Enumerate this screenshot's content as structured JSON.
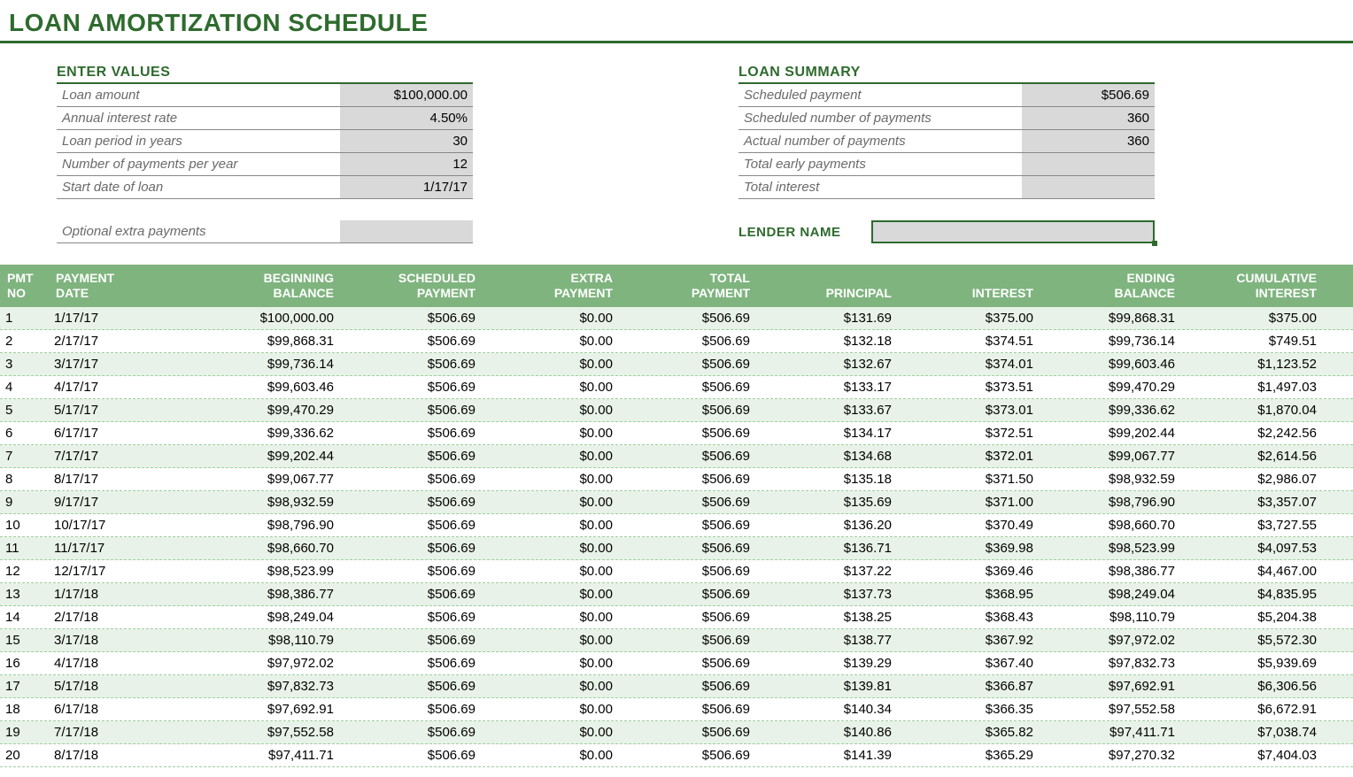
{
  "title": "LOAN AMORTIZATION SCHEDULE",
  "enter_values": {
    "heading": "ENTER VALUES",
    "rows": {
      "loan_amount": {
        "label": "Loan amount",
        "value": "$100,000.00"
      },
      "annual_rate": {
        "label": "Annual interest rate",
        "value": "4.50%"
      },
      "loan_years": {
        "label": "Loan period in years",
        "value": "30"
      },
      "payments_per_year": {
        "label": "Number of payments per year",
        "value": "12"
      },
      "start_date": {
        "label": "Start date of loan",
        "value": "1/17/17"
      },
      "optional_extra": {
        "label": "Optional extra payments",
        "value": ""
      }
    }
  },
  "loan_summary": {
    "heading": "LOAN SUMMARY",
    "rows": {
      "scheduled_payment": {
        "label": "Scheduled payment",
        "value": "$506.69"
      },
      "scheduled_num": {
        "label": "Scheduled number of payments",
        "value": "360"
      },
      "actual_num": {
        "label": "Actual number of payments",
        "value": "360"
      },
      "total_early": {
        "label": "Total early payments",
        "value": ""
      },
      "total_interest": {
        "label": "Total interest",
        "value": ""
      }
    },
    "lender_label": "LENDER NAME",
    "lender_value": ""
  },
  "schedule": {
    "headers": {
      "c0a": "PMT",
      "c0b": "NO",
      "c1a": "PAYMENT",
      "c1b": "DATE",
      "c2a": "BEGINNING",
      "c2b": "BALANCE",
      "c3a": "SCHEDULED",
      "c3b": "PAYMENT",
      "c4a": "EXTRA",
      "c4b": "PAYMENT",
      "c5a": "TOTAL",
      "c5b": "PAYMENT",
      "c6": "PRINCIPAL",
      "c7": "INTEREST",
      "c8a": "ENDING",
      "c8b": "BALANCE",
      "c9a": "CUMULATIVE",
      "c9b": "INTEREST"
    },
    "rows": [
      {
        "no": "1",
        "date": "1/17/17",
        "beg": "$100,000.00",
        "sch": "$506.69",
        "ext": "$0.00",
        "tot": "$506.69",
        "prin": "$131.69",
        "intr": "$375.00",
        "end": "$99,868.31",
        "cum": "$375.00"
      },
      {
        "no": "2",
        "date": "2/17/17",
        "beg": "$99,868.31",
        "sch": "$506.69",
        "ext": "$0.00",
        "tot": "$506.69",
        "prin": "$132.18",
        "intr": "$374.51",
        "end": "$99,736.14",
        "cum": "$749.51"
      },
      {
        "no": "3",
        "date": "3/17/17",
        "beg": "$99,736.14",
        "sch": "$506.69",
        "ext": "$0.00",
        "tot": "$506.69",
        "prin": "$132.67",
        "intr": "$374.01",
        "end": "$99,603.46",
        "cum": "$1,123.52"
      },
      {
        "no": "4",
        "date": "4/17/17",
        "beg": "$99,603.46",
        "sch": "$506.69",
        "ext": "$0.00",
        "tot": "$506.69",
        "prin": "$133.17",
        "intr": "$373.51",
        "end": "$99,470.29",
        "cum": "$1,497.03"
      },
      {
        "no": "5",
        "date": "5/17/17",
        "beg": "$99,470.29",
        "sch": "$506.69",
        "ext": "$0.00",
        "tot": "$506.69",
        "prin": "$133.67",
        "intr": "$373.01",
        "end": "$99,336.62",
        "cum": "$1,870.04"
      },
      {
        "no": "6",
        "date": "6/17/17",
        "beg": "$99,336.62",
        "sch": "$506.69",
        "ext": "$0.00",
        "tot": "$506.69",
        "prin": "$134.17",
        "intr": "$372.51",
        "end": "$99,202.44",
        "cum": "$2,242.56"
      },
      {
        "no": "7",
        "date": "7/17/17",
        "beg": "$99,202.44",
        "sch": "$506.69",
        "ext": "$0.00",
        "tot": "$506.69",
        "prin": "$134.68",
        "intr": "$372.01",
        "end": "$99,067.77",
        "cum": "$2,614.56"
      },
      {
        "no": "8",
        "date": "8/17/17",
        "beg": "$99,067.77",
        "sch": "$506.69",
        "ext": "$0.00",
        "tot": "$506.69",
        "prin": "$135.18",
        "intr": "$371.50",
        "end": "$98,932.59",
        "cum": "$2,986.07"
      },
      {
        "no": "9",
        "date": "9/17/17",
        "beg": "$98,932.59",
        "sch": "$506.69",
        "ext": "$0.00",
        "tot": "$506.69",
        "prin": "$135.69",
        "intr": "$371.00",
        "end": "$98,796.90",
        "cum": "$3,357.07"
      },
      {
        "no": "10",
        "date": "10/17/17",
        "beg": "$98,796.90",
        "sch": "$506.69",
        "ext": "$0.00",
        "tot": "$506.69",
        "prin": "$136.20",
        "intr": "$370.49",
        "end": "$98,660.70",
        "cum": "$3,727.55"
      },
      {
        "no": "11",
        "date": "11/17/17",
        "beg": "$98,660.70",
        "sch": "$506.69",
        "ext": "$0.00",
        "tot": "$506.69",
        "prin": "$136.71",
        "intr": "$369.98",
        "end": "$98,523.99",
        "cum": "$4,097.53"
      },
      {
        "no": "12",
        "date": "12/17/17",
        "beg": "$98,523.99",
        "sch": "$506.69",
        "ext": "$0.00",
        "tot": "$506.69",
        "prin": "$137.22",
        "intr": "$369.46",
        "end": "$98,386.77",
        "cum": "$4,467.00"
      },
      {
        "no": "13",
        "date": "1/17/18",
        "beg": "$98,386.77",
        "sch": "$506.69",
        "ext": "$0.00",
        "tot": "$506.69",
        "prin": "$137.73",
        "intr": "$368.95",
        "end": "$98,249.04",
        "cum": "$4,835.95"
      },
      {
        "no": "14",
        "date": "2/17/18",
        "beg": "$98,249.04",
        "sch": "$506.69",
        "ext": "$0.00",
        "tot": "$506.69",
        "prin": "$138.25",
        "intr": "$368.43",
        "end": "$98,110.79",
        "cum": "$5,204.38"
      },
      {
        "no": "15",
        "date": "3/17/18",
        "beg": "$98,110.79",
        "sch": "$506.69",
        "ext": "$0.00",
        "tot": "$506.69",
        "prin": "$138.77",
        "intr": "$367.92",
        "end": "$97,972.02",
        "cum": "$5,572.30"
      },
      {
        "no": "16",
        "date": "4/17/18",
        "beg": "$97,972.02",
        "sch": "$506.69",
        "ext": "$0.00",
        "tot": "$506.69",
        "prin": "$139.29",
        "intr": "$367.40",
        "end": "$97,832.73",
        "cum": "$5,939.69"
      },
      {
        "no": "17",
        "date": "5/17/18",
        "beg": "$97,832.73",
        "sch": "$506.69",
        "ext": "$0.00",
        "tot": "$506.69",
        "prin": "$139.81",
        "intr": "$366.87",
        "end": "$97,692.91",
        "cum": "$6,306.56"
      },
      {
        "no": "18",
        "date": "6/17/18",
        "beg": "$97,692.91",
        "sch": "$506.69",
        "ext": "$0.00",
        "tot": "$506.69",
        "prin": "$140.34",
        "intr": "$366.35",
        "end": "$97,552.58",
        "cum": "$6,672.91"
      },
      {
        "no": "19",
        "date": "7/17/18",
        "beg": "$97,552.58",
        "sch": "$506.69",
        "ext": "$0.00",
        "tot": "$506.69",
        "prin": "$140.86",
        "intr": "$365.82",
        "end": "$97,411.71",
        "cum": "$7,038.74"
      },
      {
        "no": "20",
        "date": "8/17/18",
        "beg": "$97,411.71",
        "sch": "$506.69",
        "ext": "$0.00",
        "tot": "$506.69",
        "prin": "$141.39",
        "intr": "$365.29",
        "end": "$97,270.32",
        "cum": "$7,404.03"
      }
    ]
  },
  "chart_data": {
    "type": "table",
    "title": "Loan Amortization Schedule",
    "columns": [
      "PMT NO",
      "PAYMENT DATE",
      "BEGINNING BALANCE",
      "SCHEDULED PAYMENT",
      "EXTRA PAYMENT",
      "TOTAL PAYMENT",
      "PRINCIPAL",
      "INTEREST",
      "ENDING BALANCE",
      "CUMULATIVE INTEREST"
    ],
    "rows": [
      [
        1,
        "1/17/17",
        100000.0,
        506.69,
        0.0,
        506.69,
        131.69,
        375.0,
        99868.31,
        375.0
      ],
      [
        2,
        "2/17/17",
        99868.31,
        506.69,
        0.0,
        506.69,
        132.18,
        374.51,
        99736.14,
        749.51
      ],
      [
        3,
        "3/17/17",
        99736.14,
        506.69,
        0.0,
        506.69,
        132.67,
        374.01,
        99603.46,
        1123.52
      ],
      [
        4,
        "4/17/17",
        99603.46,
        506.69,
        0.0,
        506.69,
        133.17,
        373.51,
        99470.29,
        1497.03
      ],
      [
        5,
        "5/17/17",
        99470.29,
        506.69,
        0.0,
        506.69,
        133.67,
        373.01,
        99336.62,
        1870.04
      ],
      [
        6,
        "6/17/17",
        99336.62,
        506.69,
        0.0,
        506.69,
        134.17,
        372.51,
        99202.44,
        2242.56
      ],
      [
        7,
        "7/17/17",
        99202.44,
        506.69,
        0.0,
        506.69,
        134.68,
        372.01,
        99067.77,
        2614.56
      ],
      [
        8,
        "8/17/17",
        99067.77,
        506.69,
        0.0,
        506.69,
        135.18,
        371.5,
        98932.59,
        2986.07
      ],
      [
        9,
        "9/17/17",
        98932.59,
        506.69,
        0.0,
        506.69,
        135.69,
        371.0,
        98796.9,
        3357.07
      ],
      [
        10,
        "10/17/17",
        98796.9,
        506.69,
        0.0,
        506.69,
        136.2,
        370.49,
        98660.7,
        3727.55
      ],
      [
        11,
        "11/17/17",
        98660.7,
        506.69,
        0.0,
        506.69,
        136.71,
        369.98,
        98523.99,
        4097.53
      ],
      [
        12,
        "12/17/17",
        98523.99,
        506.69,
        0.0,
        506.69,
        137.22,
        369.46,
        98386.77,
        4467.0
      ],
      [
        13,
        "1/17/18",
        98386.77,
        506.69,
        0.0,
        506.69,
        137.73,
        368.95,
        98249.04,
        4835.95
      ],
      [
        14,
        "2/17/18",
        98249.04,
        506.69,
        0.0,
        506.69,
        138.25,
        368.43,
        98110.79,
        5204.38
      ],
      [
        15,
        "3/17/18",
        98110.79,
        506.69,
        0.0,
        506.69,
        138.77,
        367.92,
        97972.02,
        5572.3
      ],
      [
        16,
        "4/17/18",
        97972.02,
        506.69,
        0.0,
        506.69,
        139.29,
        367.4,
        97832.73,
        5939.69
      ],
      [
        17,
        "5/17/18",
        97832.73,
        506.69,
        0.0,
        506.69,
        139.81,
        366.87,
        97692.91,
        6306.56
      ],
      [
        18,
        "6/17/18",
        97692.91,
        506.69,
        0.0,
        506.69,
        140.34,
        366.35,
        97552.58,
        6672.91
      ],
      [
        19,
        "7/17/18",
        97552.58,
        506.69,
        0.0,
        506.69,
        140.86,
        365.82,
        97411.71,
        7038.74
      ],
      [
        20,
        "8/17/18",
        97411.71,
        506.69,
        0.0,
        506.69,
        141.39,
        365.29,
        97270.32,
        7404.03
      ]
    ]
  }
}
